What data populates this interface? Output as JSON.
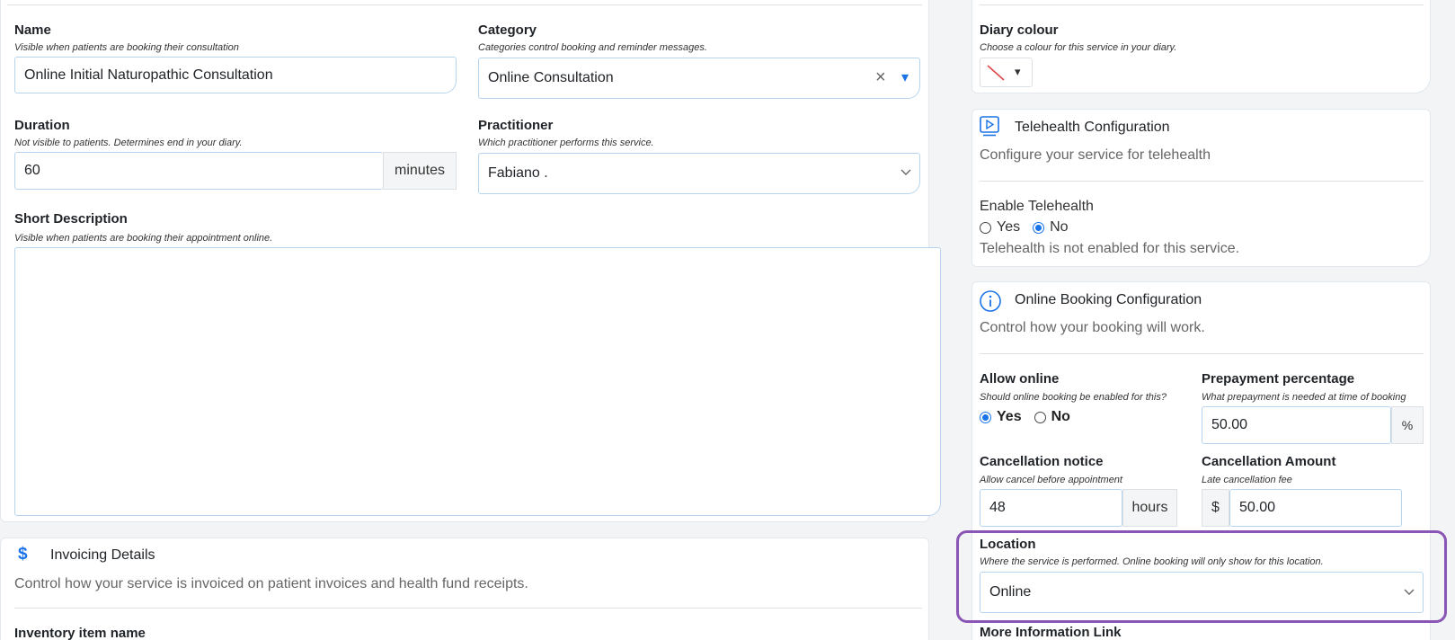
{
  "left": {
    "name": {
      "label": "Name",
      "hint": "Visible when patients are booking their consultation",
      "value": "Online Initial Naturopathic Consultation"
    },
    "category": {
      "label": "Category",
      "hint": "Categories control booking and reminder messages.",
      "value": "Online Consultation",
      "clear": "×",
      "arrow": "▾"
    },
    "duration": {
      "label": "Duration",
      "hint": "Not visible to patients. Determines end in your diary.",
      "value": "60",
      "unit": "minutes"
    },
    "practitioner": {
      "label": "Practitioner",
      "hint": "Which practitioner performs this service.",
      "value": "Fabiano ."
    },
    "short_description": {
      "label": "Short Description",
      "hint": "Visible when patients are booking their appointment online.",
      "value": ""
    },
    "invoicing": {
      "icon_glyph": "$",
      "title": "Invoicing Details",
      "description": "Control how your service is invoiced on patient invoices and health fund receipts."
    },
    "inventory_label": "Inventory item name"
  },
  "right": {
    "diary_colour": {
      "label": "Diary colour",
      "hint": "Choose a colour for this service in your diary.",
      "arrow": "▾"
    },
    "telehealth": {
      "title": "Telehealth Configuration",
      "description": "Configure your service for telehealth",
      "enable_label": "Enable Telehealth",
      "yes": "Yes",
      "no": "No",
      "status": "Telehealth is not enabled for this service."
    },
    "online_booking": {
      "title": "Online Booking Configuration",
      "description": "Control how your booking will work.",
      "allow_online": {
        "label": "Allow online",
        "hint": "Should online booking be enabled for this?",
        "yes": "Yes",
        "no": "No"
      },
      "prepayment": {
        "label": "Prepayment percentage",
        "hint": "What prepayment is needed at time of booking",
        "value": "50.00",
        "unit": "%"
      },
      "cancellation_notice": {
        "label": "Cancellation notice",
        "hint": "Allow cancel before appointment",
        "value": "48",
        "unit": "hours"
      },
      "cancellation_amount": {
        "label": "Cancellation Amount",
        "hint": "Late cancellation fee",
        "currency": "$",
        "value": "50.00"
      },
      "location": {
        "label": "Location",
        "hint": "Where the service is performed. Online booking will only show for this location.",
        "value": "Online"
      },
      "more_info_label": "More Information Link"
    }
  },
  "colors": {
    "accent": "#1a73e8",
    "highlight": "#8a55b5",
    "input_border": "#b7d4ee"
  }
}
